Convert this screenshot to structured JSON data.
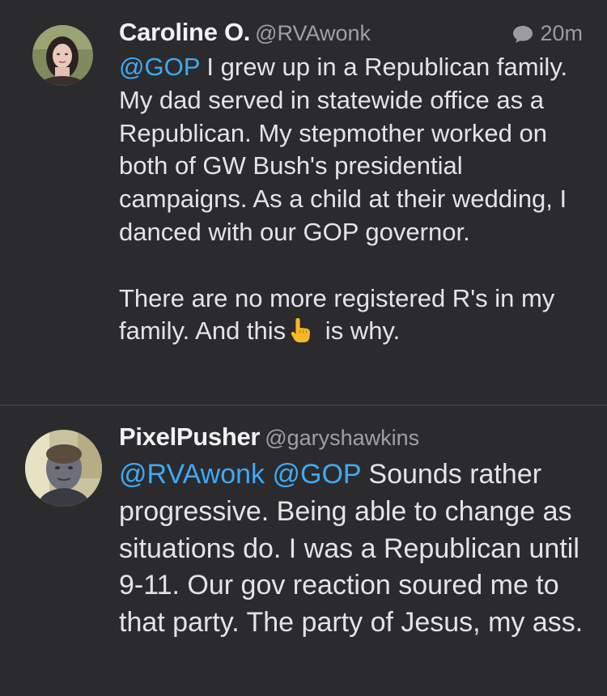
{
  "tweets": [
    {
      "display_name": "Caroline O.",
      "handle": "@RVAwonk",
      "timestamp": "20m",
      "meta_icon": "reply-bubble-icon",
      "body": {
        "mention_1": "@GOP",
        "text_1": " I grew up in a Republican family. My dad served in statewide office as a Republican. My stepmother worked on both of GW Bush's presidential campaigns. As a child at their wedding, I danced with our GOP governor.",
        "text_2_before": "There are no more registered R's in my family. And this",
        "emoji": "pointing-up-emoji",
        "text_2_after": " is why."
      }
    },
    {
      "display_name": "PixelPusher",
      "handle": "@garyshawkins",
      "body": {
        "mention_1": "@RVAwonk",
        "mention_2": "@GOP",
        "text_1": " Sounds rather progressive. Being able to change as situations do. I was a Republican until 9-11. Our gov reaction soured me to that party. The party of Jesus, my ass."
      }
    }
  ],
  "colors": {
    "background": "#2b2b2d",
    "mention": "#3fa9f5",
    "text": "#e4e4e6",
    "secondary": "#a0a0a4",
    "divider": "#4a4a4d"
  }
}
